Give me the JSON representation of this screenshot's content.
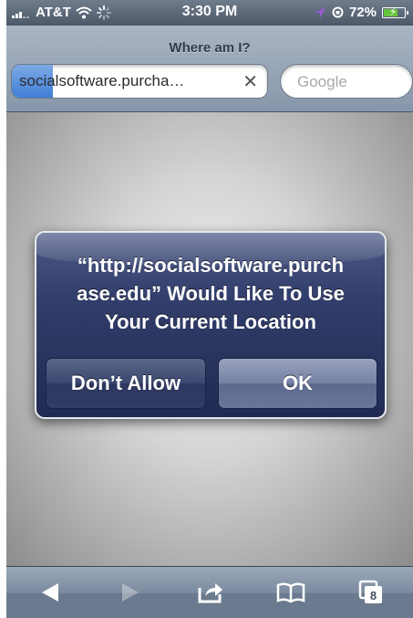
{
  "status_bar": {
    "carrier": "AT&T",
    "time": "3:30 PM",
    "battery_percent": "72%",
    "battery_level": 0.72,
    "icons": [
      "signal-bars",
      "wifi",
      "activity-spinner",
      "location-arrow",
      "lock-rotation",
      "battery-charging"
    ]
  },
  "browser": {
    "page_title": "Where am I?",
    "url_text": "socialsoftware.purcha…",
    "load_progress": 0.16,
    "clear_icon": "clear-x",
    "search_placeholder": "Google"
  },
  "alert": {
    "message_lines": [
      "“http://socialsoftware.purch",
      "ase.edu” Would Like To Use",
      "Your Current Location"
    ],
    "deny_label": "Don’t Allow",
    "ok_label": "OK"
  },
  "toolbar": {
    "items": [
      "back-arrow",
      "forward-arrow",
      "share",
      "bookmarks",
      "tabs"
    ],
    "tab_count": "8"
  },
  "colors": {
    "alert_blue": "#2c365e",
    "toolbar_gray": "#7b8a9e",
    "progress_blue": "#3f7fd6",
    "battery_green": "#64c43c"
  }
}
